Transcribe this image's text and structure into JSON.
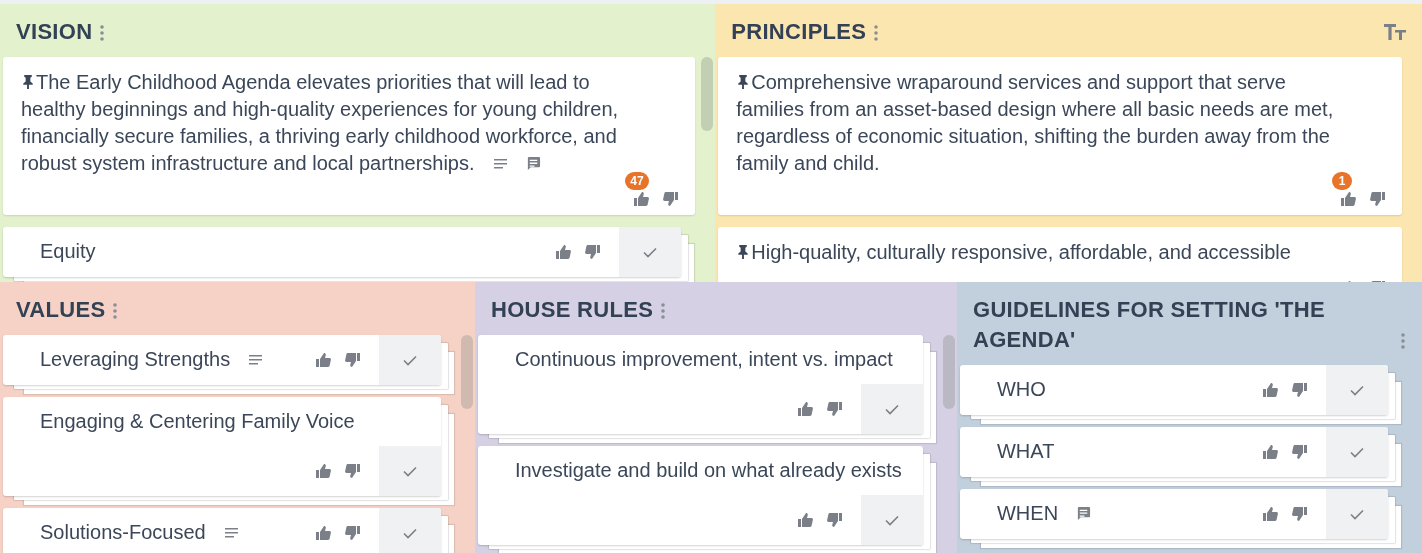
{
  "top_row": [
    {
      "title": "VISION",
      "color": "#e3f1cc",
      "scrollbar": true,
      "text_size_button": false,
      "cards": [
        {
          "kind": "pinned",
          "text": "The Early Childhood Agenda elevates priorities that will lead to healthy beginnings and high-quality experiences for young children, financially secure families, a thriving early childhood workforce, and robust system infrastructure and local partnerships.",
          "notes": true,
          "comments": true,
          "votes": "47"
        },
        {
          "kind": "item",
          "text": "Equity",
          "notes": false,
          "comments": false
        }
      ]
    },
    {
      "title": "PRINCIPLES",
      "color": "#fce6b0",
      "scrollbar": false,
      "text_size_button": true,
      "cards": [
        {
          "kind": "pinned",
          "text": "Comprehensive wraparound services and support that serve families from an asset-based design where all basic needs are met, regardless of economic situation, shifting the burden away from the family and child.",
          "notes": false,
          "comments": false,
          "votes": "1"
        },
        {
          "kind": "pinned",
          "text": "High-quality, culturally responsive, affordable, and accessible",
          "notes": false,
          "comments": false
        }
      ]
    }
  ],
  "bottom_row": [
    {
      "title": "VALUES",
      "color": "#f6d2c6",
      "scrollbar": true,
      "text_size_button": false,
      "cards": [
        {
          "kind": "item",
          "text": "Leveraging Strengths",
          "notes": true,
          "comments": false
        },
        {
          "kind": "item",
          "text": "Engaging & Centering Family Voice",
          "notes": false,
          "comments": false
        },
        {
          "kind": "item",
          "text": "Solutions-Focused",
          "notes": true,
          "comments": false
        }
      ]
    },
    {
      "title": "HOUSE RULES",
      "color": "#d6d0e4",
      "scrollbar": true,
      "text_size_button": false,
      "cards": [
        {
          "kind": "item",
          "text": "Continuous improvement, intent vs. impact",
          "notes": false,
          "comments": false
        },
        {
          "kind": "item",
          "text": "Investigate and build on what already exists",
          "notes": false,
          "comments": false
        }
      ]
    },
    {
      "title": "GUIDELINES FOR SETTING 'THE AGENDA'",
      "color": "#c2cfdc",
      "scrollbar": false,
      "text_size_button": false,
      "cards": [
        {
          "kind": "item",
          "text": "WHO",
          "notes": false,
          "comments": false
        },
        {
          "kind": "item",
          "text": "WHAT",
          "notes": false,
          "comments": false
        },
        {
          "kind": "item",
          "text": "WHEN",
          "notes": false,
          "comments": true
        }
      ]
    }
  ]
}
